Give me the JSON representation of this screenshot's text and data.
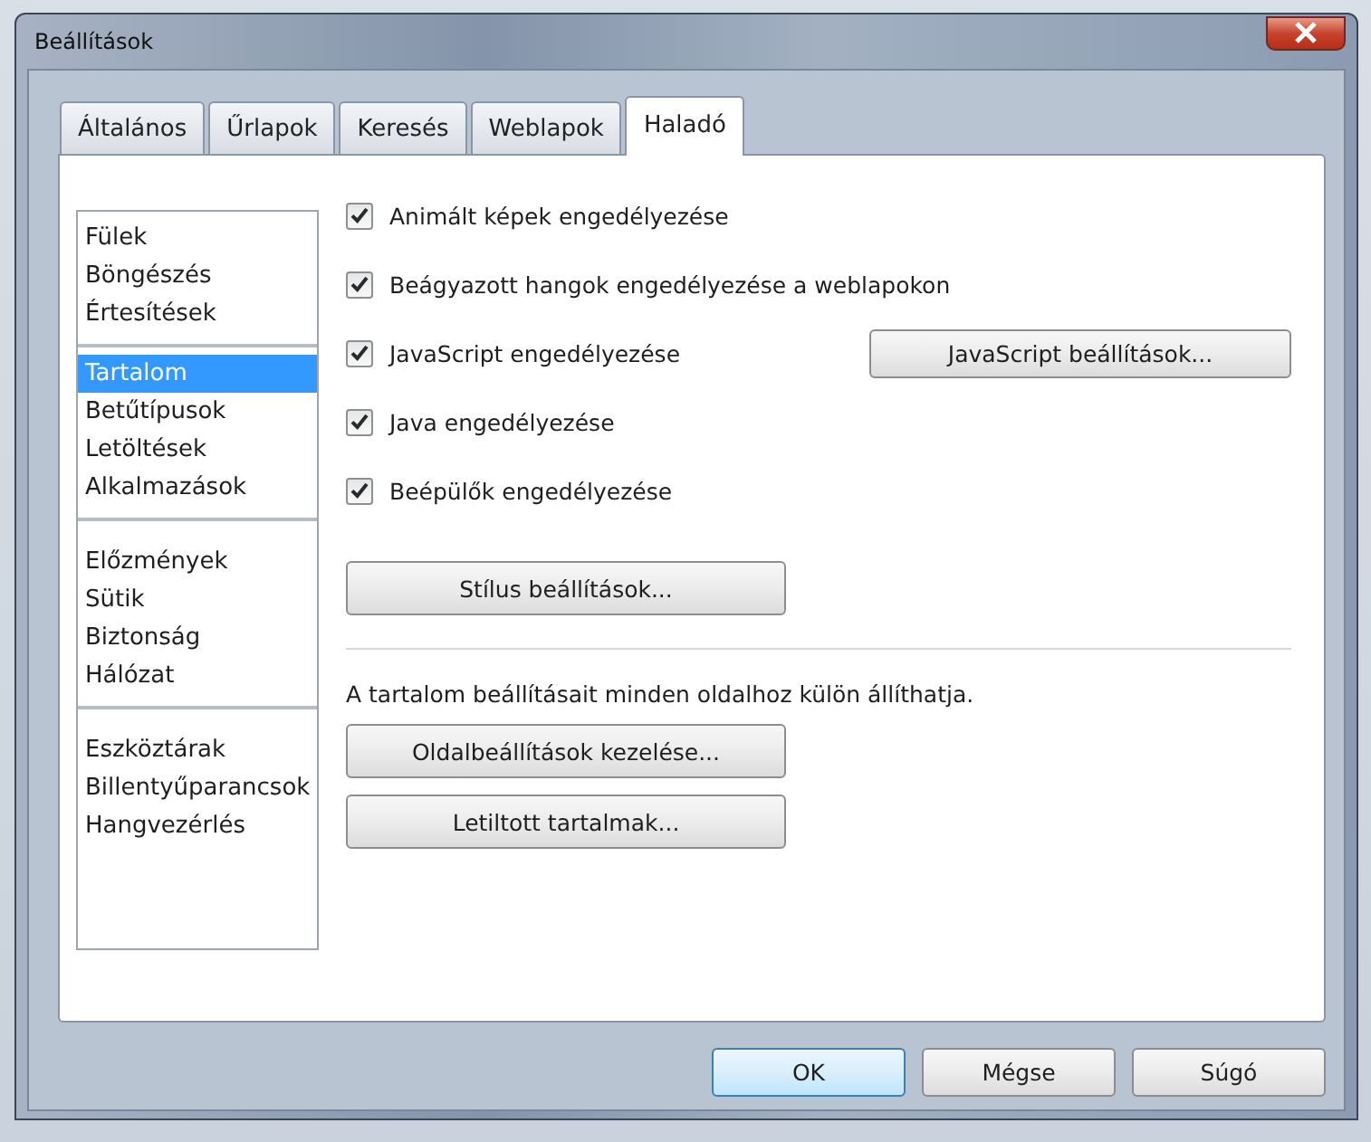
{
  "window": {
    "title": "Beállítások"
  },
  "tabs": [
    {
      "label": "Általános",
      "selected": false
    },
    {
      "label": "Űrlapok",
      "selected": false
    },
    {
      "label": "Keresés",
      "selected": false
    },
    {
      "label": "Weblapok",
      "selected": false
    },
    {
      "label": "Haladó",
      "selected": true
    }
  ],
  "sidebar": {
    "groups": [
      {
        "items": [
          {
            "label": "Fülek",
            "selected": false
          },
          {
            "label": "Böngészés",
            "selected": false
          },
          {
            "label": "Értesítések",
            "selected": false
          }
        ]
      },
      {
        "items": [
          {
            "label": "Tartalom",
            "selected": true
          },
          {
            "label": "Betűtípusok",
            "selected": false
          },
          {
            "label": "Letöltések",
            "selected": false
          },
          {
            "label": "Alkalmazások",
            "selected": false
          }
        ]
      },
      {
        "items": [
          {
            "label": "Előzmények",
            "selected": false
          },
          {
            "label": "Sütik",
            "selected": false
          },
          {
            "label": "Biztonság",
            "selected": false
          },
          {
            "label": "Hálózat",
            "selected": false
          }
        ]
      },
      {
        "items": [
          {
            "label": "Eszköztárak",
            "selected": false
          },
          {
            "label": "Billentyűparancsok",
            "selected": false
          },
          {
            "label": "Hangvezérlés",
            "selected": false
          }
        ]
      }
    ]
  },
  "options": [
    {
      "label": "Animált képek engedélyezése",
      "checked": true
    },
    {
      "label": "Beágyazott hangok engedélyezése a weblapokon",
      "checked": true
    },
    {
      "label": "JavaScript engedélyezése",
      "checked": true,
      "button": "JavaScript beállítások..."
    },
    {
      "label": "Java engedélyezése",
      "checked": true
    },
    {
      "label": "Beépülők engedélyezése",
      "checked": true
    }
  ],
  "style_button": "Stílus beállítások...",
  "site_settings": {
    "description": "A tartalom beállításait minden oldalhoz külön állíthatja.",
    "buttons": [
      "Oldalbeállítások kezelése...",
      "Letiltott tartalmak..."
    ]
  },
  "dialog_buttons": [
    {
      "label": "OK",
      "default": true
    },
    {
      "label": "Mégse",
      "default": false
    },
    {
      "label": "Súgó",
      "default": false
    }
  ]
}
